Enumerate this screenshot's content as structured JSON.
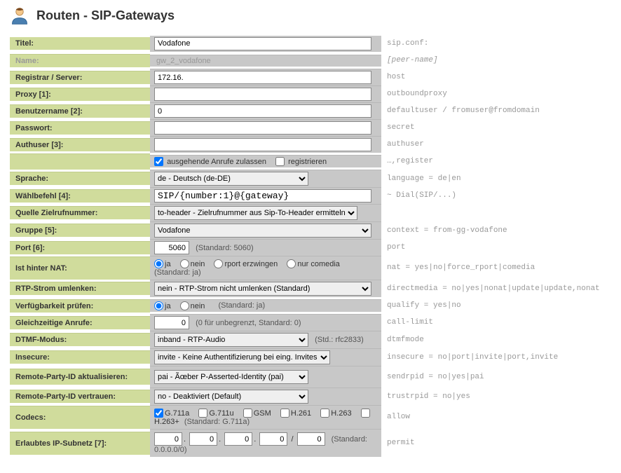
{
  "header": {
    "title": "Routen - SIP-Gateways"
  },
  "labels": {
    "title": "Titel:",
    "name": "Name:",
    "registrar": "Registrar / Server:",
    "proxy": "Proxy [1]:",
    "user": "Benutzername [2]:",
    "password": "Passwort:",
    "authuser": "Authuser [3]:",
    "lang": "Sprache:",
    "dial": "Wählbefehl [4]:",
    "source": "Quelle Zielrufnummer:",
    "group": "Gruppe [5]:",
    "port": "Port [6]:",
    "nat": "Ist hinter NAT:",
    "rtp": "RTP-Strom umlenken:",
    "qualify": "Verfügbarkeit prüfen:",
    "calllimit": "Gleichzeitige Anrufe:",
    "dtmf": "DTMF-Modus:",
    "insecure": "Insecure:",
    "rpid_update": "Remote-Party-ID aktualisieren:",
    "rpid_trust": "Remote-Party-ID vertrauen:",
    "codecs": "Codecs:",
    "subnet": "Erlaubtes IP-Subnetz [7]:"
  },
  "values": {
    "title": "Vodafone",
    "name": "gw_2_vodafone",
    "registrar": "172.16.",
    "proxy": "",
    "user": "0",
    "password": "",
    "authuser": "",
    "allow_out_checked": true,
    "register_checked": false,
    "allow_out_label": "ausgehende Anrufe zulassen",
    "register_label": "registrieren",
    "lang": "de - Deutsch (de-DE)",
    "dial": "SIP/{number:1}@{gateway}",
    "source": "to-header - Zielrufnummer aus Sip-To-Header ermitteln",
    "group": "Vodafone",
    "port": "5060",
    "port_note": "(Standard: 5060)",
    "nat_note": "(Standard: ja)",
    "rtp": "nein - RTP-Strom nicht umlenken (Standard)",
    "qualify_note": "(Standard: ja)",
    "calllimit": "0",
    "calllimit_note": "(0 für unbegrenzt, Standard: 0)",
    "dtmf": "inband - RTP-Audio",
    "dtmf_note": "(Std.: rfc2833)",
    "insecure": "invite - Keine Authentifizierung bei eing. Invites",
    "rpid_update": "pai - Ãœber P-Asserted-Identity (pai)",
    "rpid_trust": "no - Deaktiviert (Default)",
    "codecs_note": "(Standard: G.711a)",
    "subnet_a": "0",
    "subnet_b": "0",
    "subnet_c": "0",
    "subnet_d": "0",
    "subnet_mask": "0",
    "subnet_note": "(Standard: 0.0.0.0/0)"
  },
  "radios": {
    "nat": {
      "ja": "ja",
      "nein": "nein",
      "rport": "rport erzwingen",
      "comedia": "nur comedia",
      "selected": "ja"
    },
    "qualify": {
      "ja": "ja",
      "nein": "nein",
      "selected": "ja"
    }
  },
  "codecs": {
    "g711a": "G.711a",
    "g711u": "G.711u",
    "gsm": "GSM",
    "h261": "H.261",
    "h263": "H.263",
    "h263p": "H.263+"
  },
  "hints": {
    "title": "sip.conf:",
    "name": "[peer-name]",
    "registrar": "host",
    "proxy": "outboundproxy",
    "user": "defaultuser / fromuser@fromdomain",
    "password": "secret",
    "authuser": "authuser",
    "register": "…,register",
    "lang": "language = de|en",
    "dial": "~ Dial(SIP/...)",
    "source": "",
    "group": "context = from-gg-vodafone",
    "port": "port",
    "nat": "nat = yes|no|force_rport|comedia",
    "rtp": "directmedia = no|yes|nonat|update|update,nonat",
    "qualify": "qualify = yes|no",
    "calllimit": "call-limit",
    "dtmf": "dtmfmode",
    "insecure": "insecure = no|port|invite|port,invite",
    "rpid_update": "sendrpid = no|yes|pai",
    "rpid_trust": "trustrpid = no|yes",
    "codecs": "allow",
    "subnet": "permit"
  }
}
